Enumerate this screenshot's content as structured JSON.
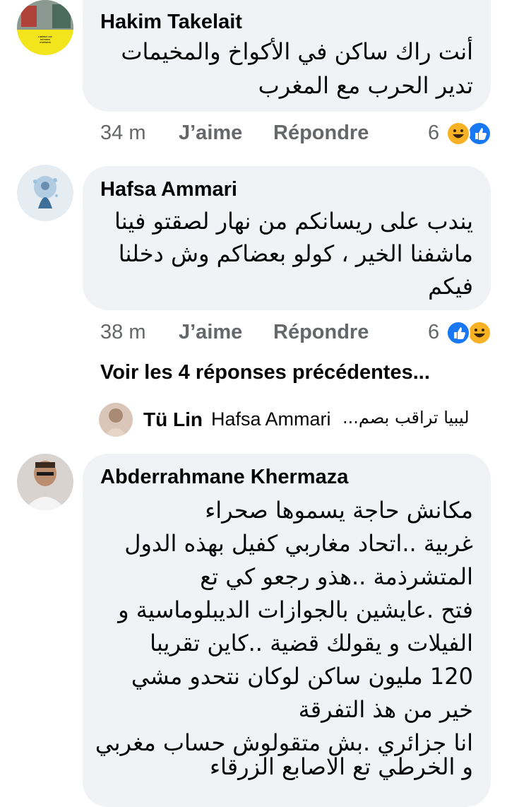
{
  "comments": [
    {
      "author": "Hakim Takelait",
      "text_lines": [
        "أنت راك ساكن في الأكواخ والمخيمات",
        "تدير الحرب مع المغرب"
      ],
      "time": "34 m",
      "like_label": "J’aime",
      "reply_label": "Répondre",
      "reaction_count": "6",
      "reactions": [
        "haha-icon",
        "like-icon"
      ],
      "avatar_caption": "LIBÉREZ LES DÉTENUS D'OPINION"
    },
    {
      "author": "Hafsa Ammari",
      "text_lines": [
        "يندب على ريسانكم من نهار لصقتو فينا",
        "ماشفنا الخير ، كولو بعضاكم وش دخلنا",
        "فيكم"
      ],
      "time": "38 m",
      "like_label": "J’aime",
      "reply_label": "Répondre",
      "reaction_count": "6",
      "reactions": [
        "like-icon",
        "haha-icon"
      ]
    },
    {
      "author": "Abderrahmane Khermaza",
      "text_lines": [
        "مكانش حاجة يسموها صحراء",
        "غربية ..اتحاد مغاربي كفيل بهذه الدول",
        "المتشرذمة ..هذو رجعو كي تع",
        "فتح .عايشين بالجوازات الديبلوماسية و",
        "الفيلات و يقولك قضية ..كاين تقريبا",
        "120 مليون ساكن لوكان نتحدو مشي",
        "خير من هذ التفرقة",
        "انا جزائري .بش متقولوش حساب مغربي",
        "و الخرطي تع الاصابع الزرقاء"
      ]
    }
  ],
  "previous_replies_link": "Voir les 4 réponses précédentes...",
  "reply_preview": {
    "author": "Tü Lin",
    "mention": "Hafsa Ammari",
    "snippet": "ليبيا تراقب بصم..."
  },
  "colors": {
    "bubble": "#f0f2f5",
    "meta": "#65676b",
    "like": "#1877f2",
    "haha": "#f7b125"
  }
}
